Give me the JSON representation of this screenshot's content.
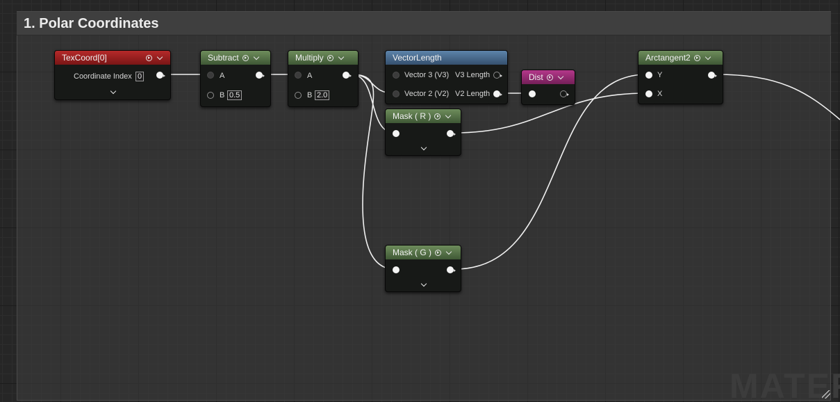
{
  "comment": {
    "title": "1. Polar Coordinates"
  },
  "colors": {
    "texcoord_header": "#9a2020",
    "math_header": "#5a7a4a",
    "vector_header": "#4a6f94",
    "dist_header": "#9a2c77",
    "wire": "#f0f0f0"
  },
  "nodes": {
    "texcoord": {
      "title": "TexCoord[0]",
      "param_label": "Coordinate Index",
      "param_value": "0"
    },
    "subtract": {
      "title": "Subtract",
      "pin_a": "A",
      "pin_b": "B",
      "b_value": "0.5"
    },
    "multiply": {
      "title": "Multiply",
      "pin_a": "A",
      "pin_b": "B",
      "b_value": "2.0"
    },
    "vectorlength": {
      "title": "VectorLength",
      "in1": "Vector 3 (V3)",
      "out1": "V3 Length",
      "in2": "Vector 2 (V2)",
      "out2": "V2 Length"
    },
    "dist": {
      "title": "Dist"
    },
    "mask_r": {
      "title": "Mask ( R )"
    },
    "mask_g": {
      "title": "Mask ( G )"
    },
    "arctangent2": {
      "title": "Arctangent2",
      "pin_y": "Y",
      "pin_x": "X"
    }
  },
  "watermark": "MATER",
  "icons": [
    "preview-play-icon",
    "chevron-down-icon",
    "resize-grip-icon"
  ]
}
